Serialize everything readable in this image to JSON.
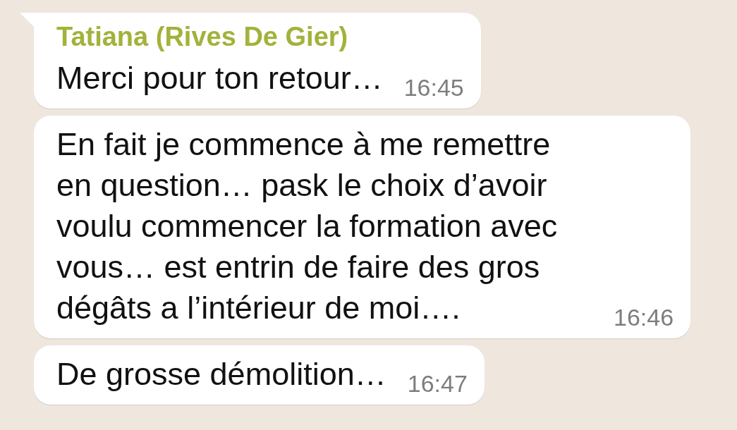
{
  "messages": [
    {
      "sender": "Tatiana (Rives De Gier)",
      "text": "Merci pour ton retour…",
      "time": "16:45",
      "tail": true
    },
    {
      "text": "En fait je commence à me remettre en question… pask le choix d’avoir voulu commencer la formation avec vous… est entrin de faire des gros dégâts a l’intérieur de moi….",
      "time": "16:46",
      "tail": false
    },
    {
      "text": "De grosse démolition…",
      "time": "16:47",
      "tail": false
    }
  ]
}
